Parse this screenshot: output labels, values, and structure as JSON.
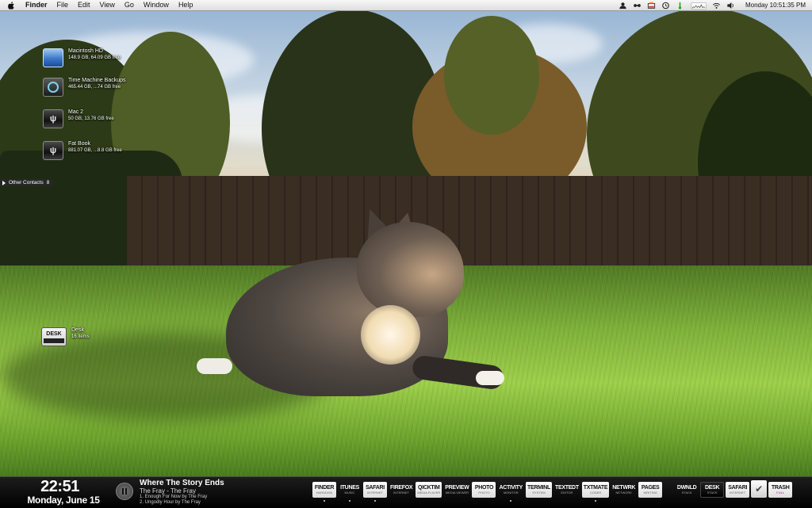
{
  "menubar": {
    "app_name": "Finder",
    "menus": [
      "File",
      "Edit",
      "View",
      "Go",
      "Window",
      "Help"
    ],
    "status_icons": [
      "user-icon",
      "bluetooth-icon",
      "battery-meter-icon",
      "time-machine-icon",
      "temperature-icon",
      "cpu-graph-icon",
      "wifi-icon",
      "volume-icon"
    ],
    "clock": "Monday 10:51:35 PM"
  },
  "desktop": {
    "volumes": [
      {
        "name": "Macintosh HD",
        "info": "148.9 GB, 64.09 GB free",
        "icon": "internal-disk-icon"
      },
      {
        "name": "Time Machine Backups",
        "info": "465.44 GB, ...74 GB free",
        "icon": "time-machine-disk-icon"
      },
      {
        "name": "Mac 2",
        "info": "50 GB, 13.76 GB free",
        "icon": "usb-disk-icon"
      },
      {
        "name": "Fat Book",
        "info": "881.07 GB, ...8.8 GB free",
        "icon": "usb-disk-icon"
      }
    ],
    "contacts_tab": {
      "label": "Other Contacts",
      "count": "8"
    },
    "desk_folder": {
      "icon_label": "DESK",
      "name": "Desk",
      "info": "16 items"
    }
  },
  "bottombar": {
    "time": "22:51",
    "date": "Monday, June 15",
    "now_playing": {
      "title": "Where The Story Ends",
      "artist": "The Fray - The Fray",
      "up_next": [
        "1. Enough For Now by The Fray",
        "2. Ungodly Hour by The Fray"
      ]
    },
    "dock": [
      {
        "label": "FINDER",
        "sub": "HARDDISK",
        "style": "light",
        "running": true
      },
      {
        "label": "ITUNES",
        "sub": "MUSIC",
        "style": "plain",
        "running": true
      },
      {
        "label": "SAFARI",
        "sub": "INTERNET",
        "style": "light",
        "running": true
      },
      {
        "label": "FIREFOX",
        "sub": "INTERNET",
        "style": "plain",
        "running": false
      },
      {
        "label": "QICKTIM",
        "sub": "MEDIA PLAYER",
        "style": "light",
        "running": false
      },
      {
        "label": "PREVIEW",
        "sub": "MEDIA VIEWER",
        "style": "plain",
        "running": false
      },
      {
        "label": "PHOTO",
        "sub": "PHOTO",
        "style": "light",
        "running": false
      },
      {
        "label": "ACTIVITY",
        "sub": "MONITOR",
        "style": "plain",
        "running": true
      },
      {
        "label": "TERMINL",
        "sub": "SYSTEM",
        "style": "light",
        "running": false
      },
      {
        "label": "TEXTEDT",
        "sub": "EDITOR",
        "style": "plain",
        "running": false
      },
      {
        "label": "TXTMATE",
        "sub": "CODER",
        "style": "light",
        "running": true
      },
      {
        "label": "NETWRK",
        "sub": "NETWORK",
        "style": "plain",
        "running": false
      },
      {
        "label": "PAGES",
        "sub": "WRITING",
        "style": "light",
        "running": false
      }
    ],
    "stacks": [
      {
        "label": "DWNLD",
        "sub": "STACK",
        "style": "plain"
      },
      {
        "label": "DESK",
        "sub": "STACK",
        "style": "dark"
      },
      {
        "label": "SAFARI",
        "sub": "INTERNET",
        "style": "light"
      }
    ],
    "trash": {
      "label": "TRASH",
      "sub": "FULL"
    }
  }
}
